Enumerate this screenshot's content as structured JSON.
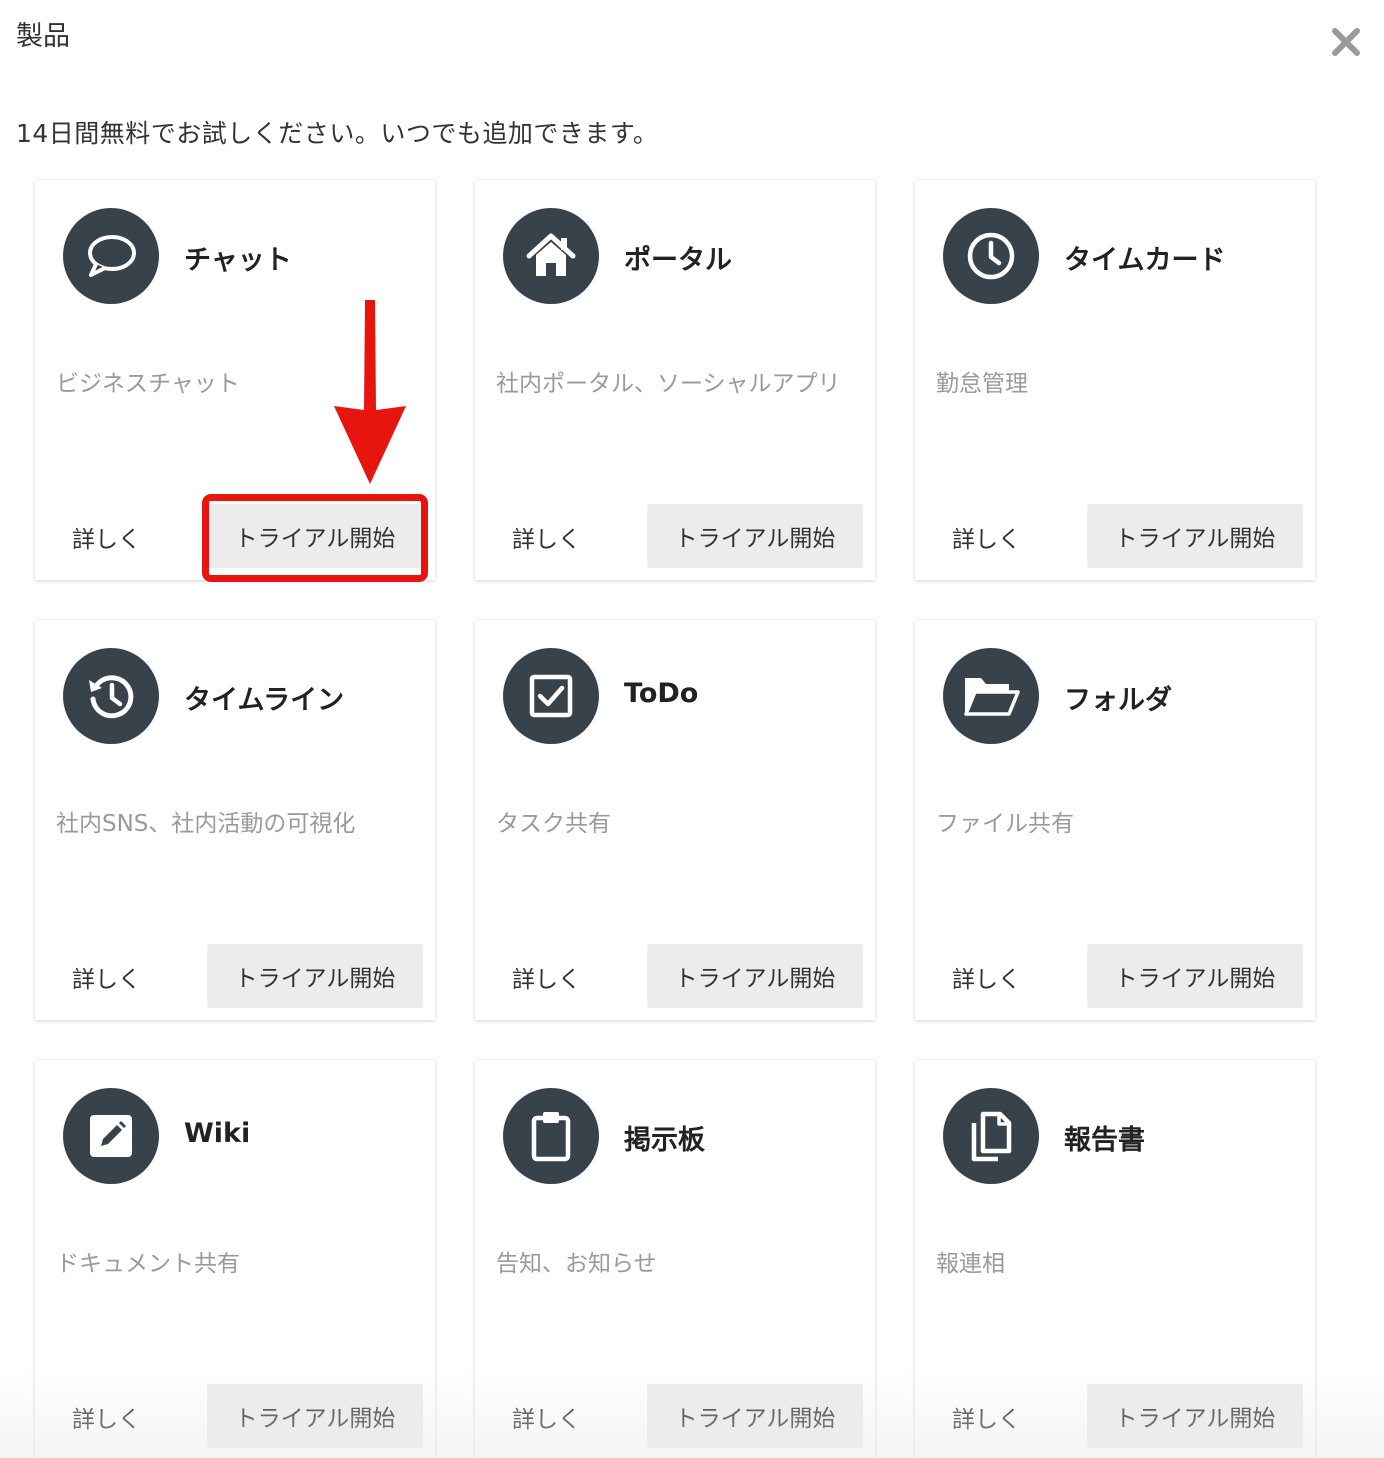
{
  "dialog": {
    "title": "製品",
    "subtitle": "14日間無料でお試しください。いつでも追加できます。"
  },
  "colors": {
    "icon_bg": "#38424a",
    "button_bg": "#ececec",
    "annotation_red": "#e8150e",
    "description_text": "#9a9a9a"
  },
  "products": [
    {
      "name": "チャット",
      "description": "ビジネスチャット",
      "icon": "chat-bubble-icon",
      "details_label": "詳しく",
      "trial_label": "トライアル開始"
    },
    {
      "name": "ポータル",
      "description": "社内ポータル、ソーシャルアプリ",
      "icon": "home-icon",
      "details_label": "詳しく",
      "trial_label": "トライアル開始"
    },
    {
      "name": "タイムカード",
      "description": "勤怠管理",
      "icon": "clock-icon",
      "details_label": "詳しく",
      "trial_label": "トライアル開始"
    },
    {
      "name": "タイムライン",
      "description": "社内SNS、社内活動の可視化",
      "icon": "history-icon",
      "details_label": "詳しく",
      "trial_label": "トライアル開始"
    },
    {
      "name": "ToDo",
      "description": "タスク共有",
      "icon": "checkbox-icon",
      "details_label": "詳しく",
      "trial_label": "トライアル開始"
    },
    {
      "name": "フォルダ",
      "description": "ファイル共有",
      "icon": "folder-open-icon",
      "details_label": "詳しく",
      "trial_label": "トライアル開始"
    },
    {
      "name": "Wiki",
      "description": "ドキュメント共有",
      "icon": "edit-icon",
      "details_label": "詳しく",
      "trial_label": "トライアル開始"
    },
    {
      "name": "掲示板",
      "description": "告知、お知らせ",
      "icon": "clipboard-icon",
      "details_label": "詳しく",
      "trial_label": "トライアル開始"
    },
    {
      "name": "報告書",
      "description": "報連相",
      "icon": "copy-icon",
      "details_label": "詳しく",
      "trial_label": "トライアル開始"
    }
  ]
}
